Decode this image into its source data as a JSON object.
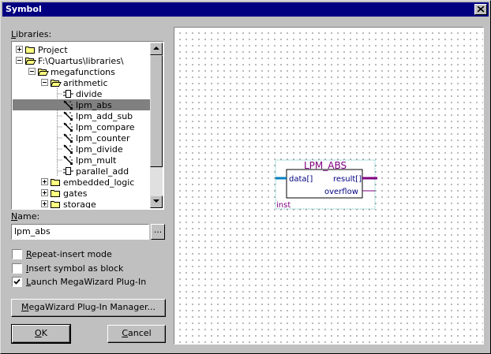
{
  "window": {
    "title": "Symbol"
  },
  "libraries": {
    "label_pre": "",
    "label_accel": "L",
    "label_post": "ibraries:",
    "tree": [
      {
        "text": "Project",
        "level": 0,
        "expander": "plus",
        "icon": "folder-icon"
      },
      {
        "text": "F:\\Quartus\\libraries\\",
        "level": 0,
        "expander": "minus",
        "icon": "folder-open-icon"
      },
      {
        "text": "megafunctions",
        "level": 1,
        "expander": "minus",
        "icon": "folder-open-icon"
      },
      {
        "text": "arithmetic",
        "level": 2,
        "expander": "minus",
        "icon": "folder-open-icon"
      },
      {
        "text": "divide",
        "level": 3,
        "expander": "none",
        "icon": "block-symbol-icon"
      },
      {
        "text": "lpm_abs",
        "level": 3,
        "expander": "none",
        "icon": "megawizard-icon",
        "selected": true
      },
      {
        "text": "lpm_add_sub",
        "level": 3,
        "expander": "none",
        "icon": "megawizard-icon"
      },
      {
        "text": "lpm_compare",
        "level": 3,
        "expander": "none",
        "icon": "megawizard-icon"
      },
      {
        "text": "lpm_counter",
        "level": 3,
        "expander": "none",
        "icon": "megawizard-icon"
      },
      {
        "text": "lpm_divide",
        "level": 3,
        "expander": "none",
        "icon": "megawizard-icon"
      },
      {
        "text": "lpm_mult",
        "level": 3,
        "expander": "none",
        "icon": "megawizard-icon"
      },
      {
        "text": "parallel_add",
        "level": 3,
        "expander": "none",
        "icon": "block-symbol-icon"
      },
      {
        "text": "embedded_logic",
        "level": 2,
        "expander": "plus",
        "icon": "folder-icon"
      },
      {
        "text": "gates",
        "level": 2,
        "expander": "plus",
        "icon": "folder-icon"
      },
      {
        "text": "storage",
        "level": 2,
        "expander": "plus",
        "icon": "folder-icon"
      }
    ]
  },
  "name": {
    "label_accel": "N",
    "label_post": "ame:",
    "value": "lpm_abs",
    "browse_label": "..."
  },
  "options": [
    {
      "accel": "R",
      "rest": "epeat-insert mode",
      "checked": false
    },
    {
      "accel": "I",
      "rest": "nsert symbol as block",
      "checked": false
    },
    {
      "accel": "L",
      "rest": "aunch MegaWizard Plug-In",
      "checked": true
    }
  ],
  "buttons": {
    "megawizard_accel": "M",
    "megawizard_rest": "egaWizard Plug-In Manager...",
    "ok_accel": "O",
    "ok_rest": "K",
    "cancel_accel": "C",
    "cancel_rest": "ancel"
  },
  "preview": {
    "symbol_name": "LPM_ABS",
    "port_in": "data[]",
    "port_result": "result[]",
    "port_overflow": "overflow",
    "instance": "inst",
    "colors": {
      "title": "#800080",
      "port_text": "#000080",
      "bus": "#0080c0",
      "out_bus": "#800080"
    }
  }
}
